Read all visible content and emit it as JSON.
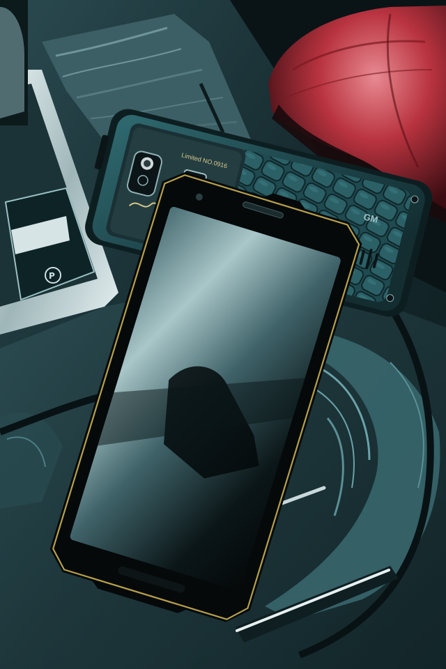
{
  "photo": {
    "subject": "rugged-smartphones-on-car-console",
    "back_phone": {
      "engraving": "Limited NO.0916",
      "brand_mark": "GM"
    },
    "console": {
      "parking_brake_symbol": "(P)"
    },
    "colors": {
      "console_wood": "#1d3438",
      "wood_grain": "#2f5158",
      "seat_leather": "#b8333f",
      "phone_back_teal": "#1f4c52",
      "phone_front_glass": "#0a1416",
      "gold_trim": "#b8a04a",
      "chrome": "#c8d8da"
    }
  }
}
